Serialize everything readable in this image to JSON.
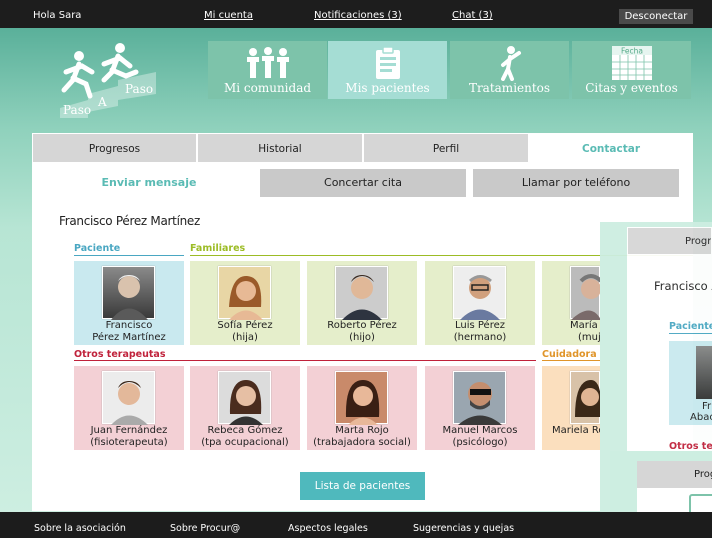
{
  "topbar": {
    "greeting": "Hola Sara",
    "account": "Mi cuenta",
    "notifications": "Notificaciones (3)",
    "chat": "Chat (3)",
    "logout": "Desconectar"
  },
  "logo": {
    "w1": "Paso",
    "w2": "A",
    "w3": "Paso"
  },
  "nav": [
    {
      "label": "Mi comunidad",
      "icon": "community-icon"
    },
    {
      "label": "Mis pacientes",
      "icon": "clipboard-icon"
    },
    {
      "label": "Tratamientos",
      "icon": "exercise-icon"
    },
    {
      "label": "Citas y eventos",
      "icon": "calendar-icon",
      "icon_caption": "Fecha"
    }
  ],
  "tabs": [
    "Progresos",
    "Historial",
    "Perfil",
    "Contactar"
  ],
  "subtabs": {
    "send": "Enviar mensaje",
    "appointment": "Concertar cita",
    "call": "Llamar por teléfono"
  },
  "patient_name": "Francisco Pérez Martínez",
  "sections": {
    "patient": "Paciente",
    "family": "Familiares",
    "therapists": "Otros terapeutas",
    "carer": "Cuidadora"
  },
  "patient": {
    "line1": "Francisco",
    "line2": "Pérez Martínez"
  },
  "family": [
    {
      "line1": "Sofía Pérez",
      "line2": "(hija)"
    },
    {
      "line1": "Roberto Pérez",
      "line2": "(hijo)"
    },
    {
      "line1": "Luis Pérez",
      "line2": "(hermano)"
    },
    {
      "line1": "María",
      "line2": "(muj"
    }
  ],
  "therapists": [
    {
      "line1": "Juan Fernández",
      "line2": "(fisioterapeuta)"
    },
    {
      "line1": "Rebeca Gómez",
      "line2": "(tpa ocupacional)"
    },
    {
      "line1": "Marta Rojo",
      "line2": "(trabajadora social)"
    },
    {
      "line1": "Manuel Marcos",
      "line2": "(psicólogo)"
    }
  ],
  "carer": {
    "line1": "Mariela Ro"
  },
  "list_button": "Lista de pacientes",
  "footer": [
    "Sobre la asociación",
    "Sobre Procur@",
    "Aspectos legales",
    "Sugerencias y quejas"
  ],
  "ghost": {
    "tab": "Progr",
    "name": "Francisco A",
    "section": "Paciente",
    "card_l1": "Fr",
    "card_l2": "Abac",
    "tab2": "Prog",
    "sec2": "Otros ter"
  }
}
